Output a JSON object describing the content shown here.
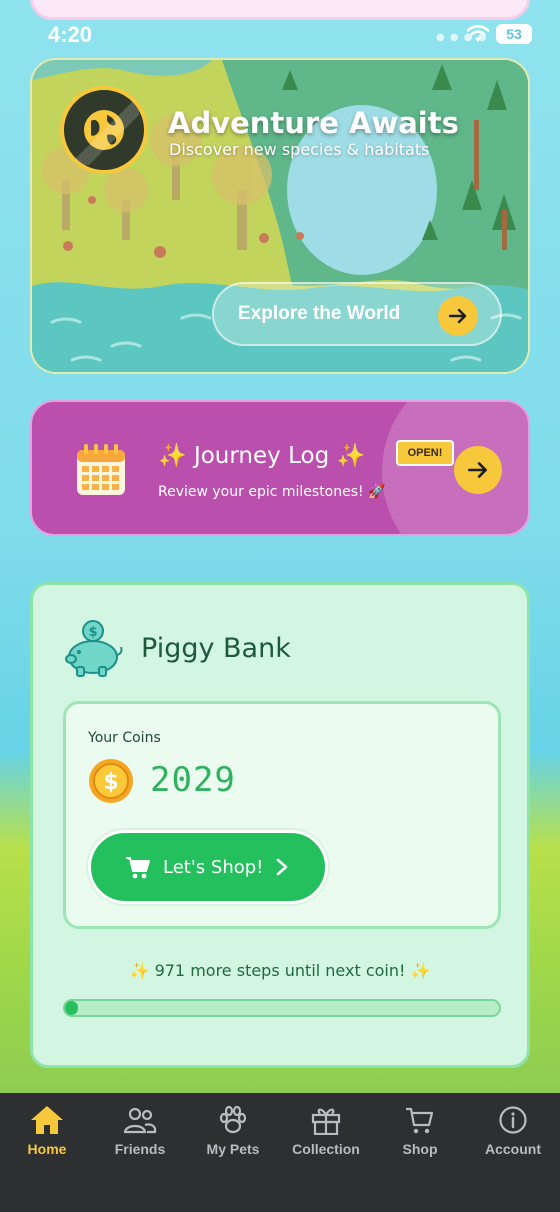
{
  "status_bar": {
    "time": "4:20",
    "battery": "53"
  },
  "adventure": {
    "title": "Adventure Awaits",
    "subtitle": "Discover new species & habitats",
    "button_label": "Explore the World"
  },
  "journey": {
    "title": "✨ Journey Log ✨",
    "subtitle": "Review your epic milestones! 🚀",
    "badge": "OPEN!"
  },
  "piggy_bank": {
    "title": "Piggy Bank",
    "coins_label": "Your Coins",
    "coins_value": "2029",
    "shop_button_label": "Let's Shop!",
    "steps_message": "✨ 971 more steps until next coin! ✨",
    "progress": 0.03
  },
  "tabs": [
    {
      "label": "Home",
      "icon": "home-icon",
      "active": true
    },
    {
      "label": "Friends",
      "icon": "friends-icon",
      "active": false
    },
    {
      "label": "My Pets",
      "icon": "paw-icon",
      "active": false
    },
    {
      "label": "Collection",
      "icon": "gift-icon",
      "active": false
    },
    {
      "label": "Shop",
      "icon": "cart-icon",
      "active": false
    },
    {
      "label": "Account",
      "icon": "info-icon",
      "active": false
    }
  ],
  "colors": {
    "accent_yellow": "#f7c83c",
    "journey_purple": "#bb4fae",
    "piggy_green": "#24c05e",
    "tab_bar": "#2d2f30"
  }
}
